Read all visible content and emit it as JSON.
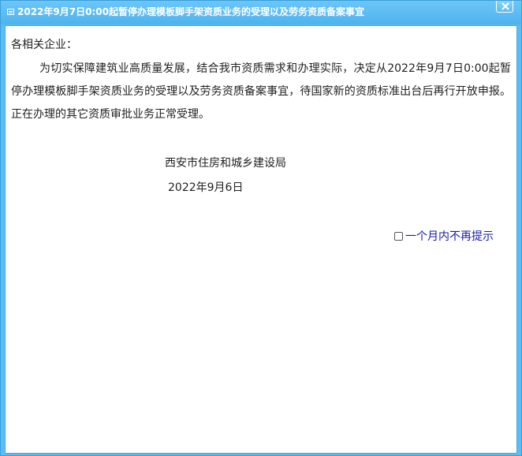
{
  "window": {
    "title": "2022年9月7日0:00起暂停办理模板脚手架资质业务的受理以及劳务资质备案事宜",
    "title_icon": "window-icon",
    "close_icon": "close-icon"
  },
  "notice": {
    "greeting": "各相关企业：",
    "body": "为切实保障建筑业高质量发展，结合我市资质需求和办理实际，决定从2022年9月7日0:00起暂停办理模板脚手架资质业务的受理以及劳务资质备案事宜，待国家新的资质标准出台后再行开放申报。正在办理的其它资质审批业务正常受理。",
    "signer": "西安市住房和城乡建设局",
    "date": "2022年9月6日"
  },
  "options": {
    "dont_show_label": "一个月内不再提示",
    "dont_show_checked": false
  },
  "colors": {
    "frame": "#5bbdf4",
    "link": "#1a1aaa"
  }
}
